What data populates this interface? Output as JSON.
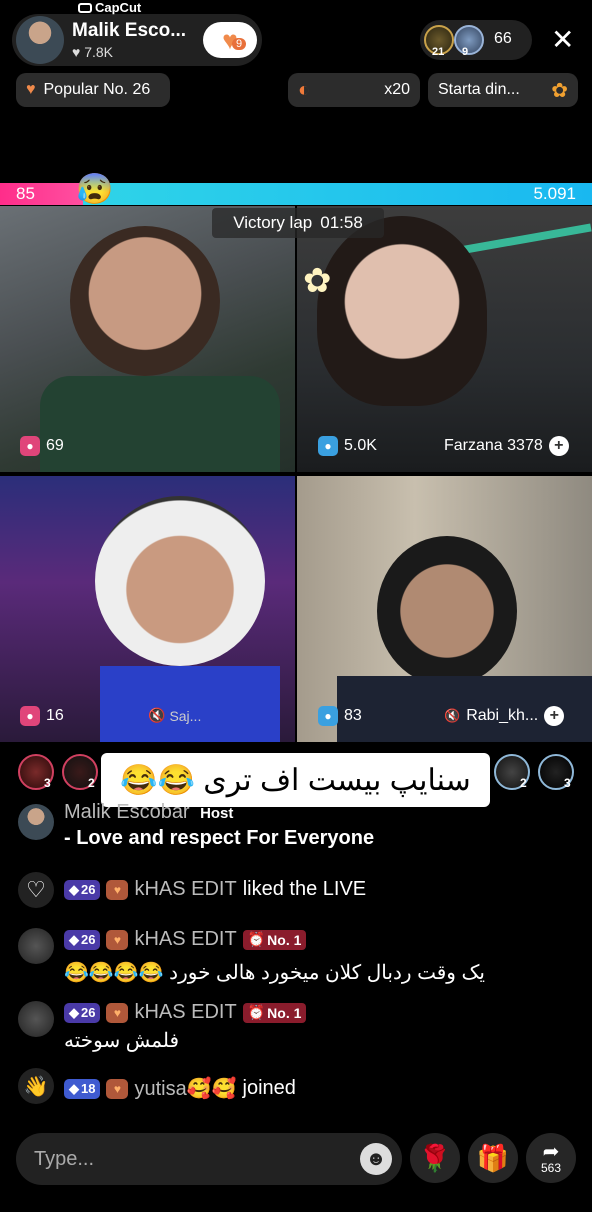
{
  "brand": {
    "name": "CapCut"
  },
  "host": {
    "name": "Malik Esco...",
    "likes": "7.8K",
    "follow_badge": "9"
  },
  "viewers": {
    "badges": [
      "21",
      "9"
    ],
    "count": "66"
  },
  "pills": {
    "popular": "Popular No. 26",
    "multiplier": "x20",
    "starta": "Starta din..."
  },
  "battle": {
    "left_score": "85",
    "right_score": "5.091",
    "timer_label": "Victory lap",
    "timer_value": "01:58"
  },
  "guests": [
    {
      "score": "69",
      "name": "",
      "mute": ""
    },
    {
      "score": "5.0K",
      "name": "Farzana 3378",
      "mute": ""
    },
    {
      "score": "16",
      "name": "",
      "mute": "Saj..."
    },
    {
      "score": "83",
      "name": "Rabi_kh...",
      "mute": ""
    }
  ],
  "avatar_row": {
    "badges": [
      "3",
      "2",
      "2",
      "3"
    ]
  },
  "big_message": "سنایپ بیست اف تری 😂😂",
  "chat": {
    "host_name": "Malik Escobar",
    "host_tag": "Host",
    "host_text": "- Love and respect For Everyone",
    "liked_level": "26",
    "liked_user": "kHAS EDIT",
    "liked_text": "liked the LIVE",
    "msg1_level": "26",
    "msg1_user": "kHAS EDIT",
    "msg1_rank": "No. 1",
    "msg1_text": "یک وقت ردبال کلان میخورد هالی خورد 😂😂😂😂",
    "msg2_level": "26",
    "msg2_user": "kHAS EDIT",
    "msg2_rank": "No. 1",
    "msg2_text": "فلمش سوخته",
    "join_level": "18",
    "join_user": "yutisa🥰🥰",
    "join_text": "joined"
  },
  "input": {
    "placeholder": "Type...",
    "share_count": "563"
  },
  "colors": {
    "left_bar": "#ff2d8a",
    "right_bar": "#19b8f0",
    "accent": "#f08a4b"
  }
}
